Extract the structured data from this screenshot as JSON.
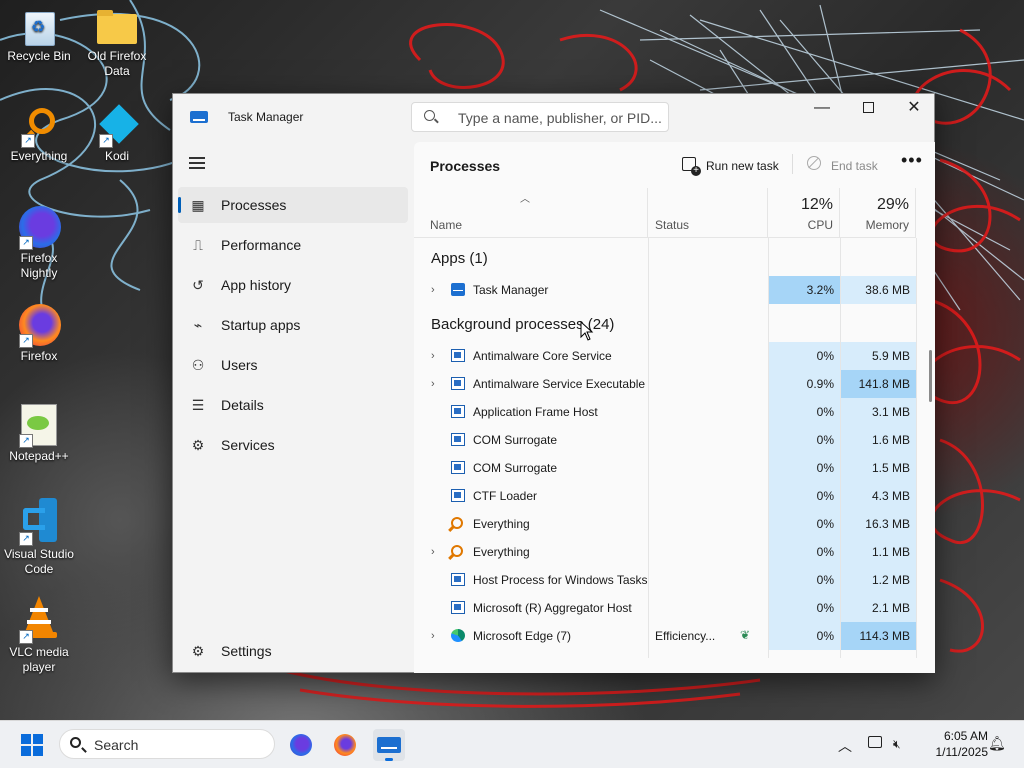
{
  "desktop": {
    "icons": [
      {
        "label": "Recycle Bin"
      },
      {
        "label": "Old Firefox Data"
      },
      {
        "label": "Everything"
      },
      {
        "label": "Kodi"
      },
      {
        "label": "Firefox Nightly"
      },
      {
        "label": "Firefox"
      },
      {
        "label": "Notepad++"
      },
      {
        "label": "Visual Studio Code"
      },
      {
        "label": "VLC media player"
      }
    ]
  },
  "window": {
    "title": "Task Manager",
    "search_placeholder": "Type a name, publisher, or PID...",
    "controls": {
      "minimize": "—",
      "maximize": "□",
      "close": "✕"
    }
  },
  "nav": {
    "items": [
      {
        "label": "Processes",
        "icon": "processes-icon",
        "active": true
      },
      {
        "label": "Performance",
        "icon": "performance-icon"
      },
      {
        "label": "App history",
        "icon": "app-history-icon"
      },
      {
        "label": "Startup apps",
        "icon": "startup-apps-icon"
      },
      {
        "label": "Users",
        "icon": "users-icon"
      },
      {
        "label": "Details",
        "icon": "details-icon"
      },
      {
        "label": "Services",
        "icon": "services-icon"
      }
    ],
    "settings": "Settings"
  },
  "page": {
    "title": "Processes",
    "run_new_task": "Run new task",
    "end_task": "End task",
    "more": "•••"
  },
  "table": {
    "columns": {
      "name": "Name",
      "status": "Status",
      "cpu_label": "CPU",
      "cpu_pct": "12%",
      "mem_label": "Memory",
      "mem_pct": "29%"
    },
    "groups": {
      "apps": "Apps (1)",
      "background": "Background processes (24)"
    },
    "apps": [
      {
        "name": "Task Manager",
        "cpu": "3.2%",
        "mem": "38.6 MB",
        "expandable": true,
        "icon": "task-manager-icon"
      }
    ],
    "background": [
      {
        "name": "Antimalware Core Service",
        "cpu": "0%",
        "mem": "5.9 MB",
        "expandable": true,
        "icon": "windows-process-icon"
      },
      {
        "name": "Antimalware Service Executable",
        "cpu": "0.9%",
        "mem": "141.8 MB",
        "expandable": true,
        "icon": "windows-process-icon"
      },
      {
        "name": "Application Frame Host",
        "cpu": "0%",
        "mem": "3.1 MB",
        "icon": "windows-process-icon"
      },
      {
        "name": "COM Surrogate",
        "cpu": "0%",
        "mem": "1.6 MB",
        "icon": "windows-process-icon"
      },
      {
        "name": "COM Surrogate",
        "cpu": "0%",
        "mem": "1.5 MB",
        "icon": "windows-process-icon"
      },
      {
        "name": "CTF Loader",
        "cpu": "0%",
        "mem": "4.3 MB",
        "icon": "windows-process-icon"
      },
      {
        "name": "Everything",
        "cpu": "0%",
        "mem": "16.3 MB",
        "icon": "everything-icon"
      },
      {
        "name": "Everything",
        "cpu": "0%",
        "mem": "1.1 MB",
        "expandable": true,
        "icon": "everything-icon"
      },
      {
        "name": "Host Process for Windows Tasks",
        "cpu": "0%",
        "mem": "1.2 MB",
        "icon": "windows-process-icon"
      },
      {
        "name": "Microsoft (R) Aggregator Host",
        "cpu": "0%",
        "mem": "2.1 MB",
        "icon": "windows-process-icon"
      },
      {
        "name": "Microsoft Edge (7)",
        "status": "Efficiency...",
        "cpu": "0%",
        "mem": "114.3 MB",
        "expandable": true,
        "icon": "edge-icon",
        "efficiency_icon": "leaf-icon"
      }
    ]
  },
  "taskbar": {
    "search_label": "Search",
    "apps": [
      {
        "name": "firefox-nightly-taskbar-icon"
      },
      {
        "name": "firefox-taskbar-icon"
      },
      {
        "name": "task-manager-taskbar-icon",
        "active": true
      }
    ],
    "time": "6:05 AM",
    "date": "1/11/2025"
  },
  "colors": {
    "accent": "#005fb8",
    "heat_light": "#d7ecfb",
    "heat_medium": "#a6d5f7"
  }
}
